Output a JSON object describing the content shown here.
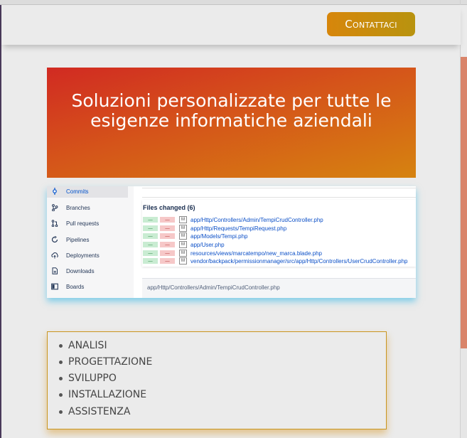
{
  "header": {
    "contact_label": "Contattaci"
  },
  "hero": {
    "title": "Soluzioni personalizzate per tutte le esigenze informatiche aziendali"
  },
  "screenshot": {
    "sidebar": {
      "items": [
        {
          "label": "Commits",
          "icon": "commit-icon",
          "active": true
        },
        {
          "label": "Branches",
          "icon": "branch-icon",
          "active": false
        },
        {
          "label": "Pull requests",
          "icon": "pull-request-icon",
          "active": false
        },
        {
          "label": "Pipelines",
          "icon": "pipeline-icon",
          "active": false
        },
        {
          "label": "Deployments",
          "icon": "deployment-icon",
          "active": false
        },
        {
          "label": "Downloads",
          "icon": "download-icon",
          "active": false
        },
        {
          "label": "Boards",
          "icon": "board-icon",
          "active": false
        }
      ]
    },
    "files_changed": {
      "title": "Files changed (6)",
      "added_glyph": "—",
      "removed_glyph": "—",
      "modified_badge": "M",
      "files": [
        "app/Http/Controllers/Admin/TempiCrudController.php",
        "app/Http/Requests/TempiRequest.php",
        "app/Models/Tempi.php",
        "app/User.php",
        "resources/views/marcatempo/new_marca.blade.php",
        "vendor/backpack/permissionmanager/src/app/Http/Controllers/UserCrudController.php"
      ]
    },
    "path_bar": "app/Http/Controllers/Admin/TempiCrudController.php"
  },
  "services": {
    "items": [
      "ANALISI",
      "PROGETTAZIONE",
      "SVILUPPO",
      "INSTALLAZIONE",
      "ASSISTENZA"
    ]
  },
  "colors": {
    "accent": "#d7860b",
    "hero_start": "#d12a22",
    "hero_end": "#d68310",
    "link": "#0b4fc7"
  }
}
